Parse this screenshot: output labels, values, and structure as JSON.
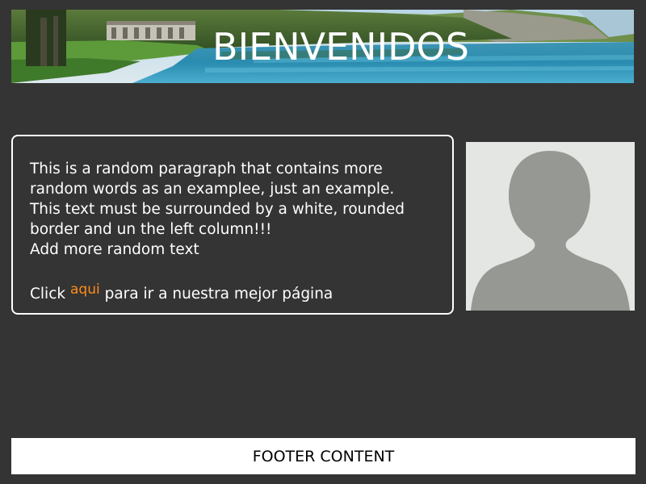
{
  "header": {
    "title": "BIENVENIDOS",
    "image_icon": "lake-landscape-banner"
  },
  "content": {
    "paragraph_lines": [
      "This is a random paragraph that contains more",
      "random words as an examplee, just an example.",
      "This text must be surrounded by a white, rounded",
      "border and un the left column!!!"
    ],
    "extra_line": "Add more random text",
    "click_prefix": "Click",
    "link_text": "aqui",
    "click_suffix": "para ir a nuestra mejor página"
  },
  "avatar": {
    "icon": "user-silhouette-icon"
  },
  "footer": {
    "text": "FOOTER CONTENT"
  },
  "colors": {
    "background": "#343434",
    "text": "#ffffff",
    "link": "#ff8c1a",
    "avatar_bg": "#e4e6e3",
    "avatar_figure": "#969894"
  }
}
